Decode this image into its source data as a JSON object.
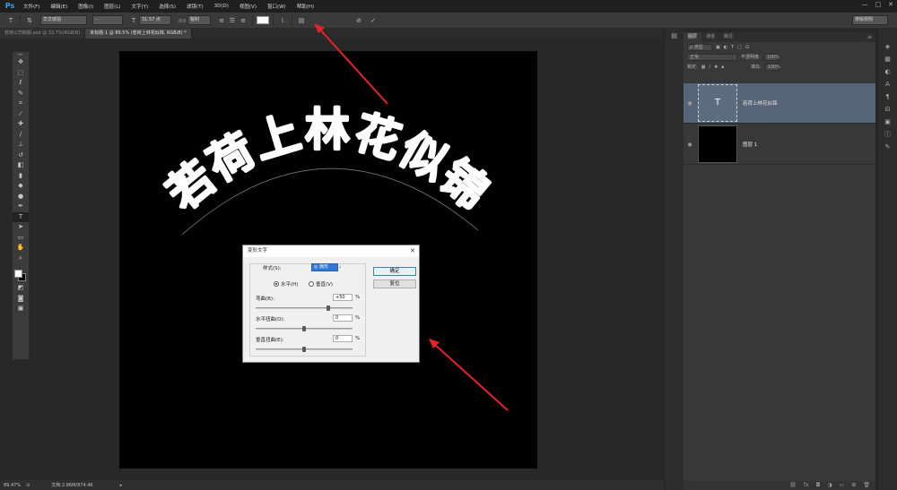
{
  "app": {
    "logo": "Ps"
  },
  "menu": [
    "文件(F)",
    "编辑(E)",
    "图像(I)",
    "图层(L)",
    "文字(Y)",
    "选择(S)",
    "滤镜(T)",
    "3D(D)",
    "视图(V)",
    "窗口(W)",
    "帮助(H)"
  ],
  "window_controls": {
    "minimize": "—",
    "restore": "□",
    "close": "✕"
  },
  "options_bar": {
    "font_family": "华文琥珀",
    "font_style": "-",
    "font_size": "31.57 点",
    "antialias_label": "aa",
    "antialias": "锐利",
    "workspace": "排版规则"
  },
  "tabs": [
    {
      "label": "若荷公司制服.psd @ 33.7%(RGB/8)",
      "active": false
    },
    {
      "label": "未标题-1 @ 89.5% (若荷上林花似锦, RGB/8) *",
      "active": true
    }
  ],
  "canvas": {
    "arc_text": "若荷上林花似锦",
    "text_color": "#ffffff",
    "background": "#000000"
  },
  "annotations": {
    "arrow_color": "#e5242a"
  },
  "status": {
    "zoom": "89.47%",
    "doc": "文档:2.86M/874.4K"
  },
  "layers_panel": {
    "tabs": [
      "图层",
      "通道",
      "路径"
    ],
    "filter_label": "ρ 类型",
    "blend_mode": "正常",
    "opacity_label": "不透明度:",
    "opacity_value": "100%",
    "lock_label": "锁定:",
    "fill_label": "填充:",
    "fill_value": "100%",
    "layers": [
      {
        "name": "若荷上林花似锦",
        "thumb": "T",
        "selected": true
      },
      {
        "name": "图层 1",
        "thumb": "",
        "selected": false
      }
    ]
  },
  "dialog": {
    "title": "变形文字",
    "close": "✕",
    "style_label": "样式(S):",
    "style_value": "◎ 扇形",
    "horizontal": "水平(H)",
    "vertical": "垂直(V)",
    "bend_label": "弯曲(B):",
    "bend_value": "+50",
    "hdist_label": "水平扭曲(O):",
    "hdist_value": "0",
    "vdist_label": "垂直扭曲(E):",
    "vdist_value": "0",
    "percent": "%",
    "ok": "确定",
    "reset": "复位",
    "bend_pct": 0.75,
    "hdist_pct": 0.5,
    "vdist_pct": 0.5
  }
}
